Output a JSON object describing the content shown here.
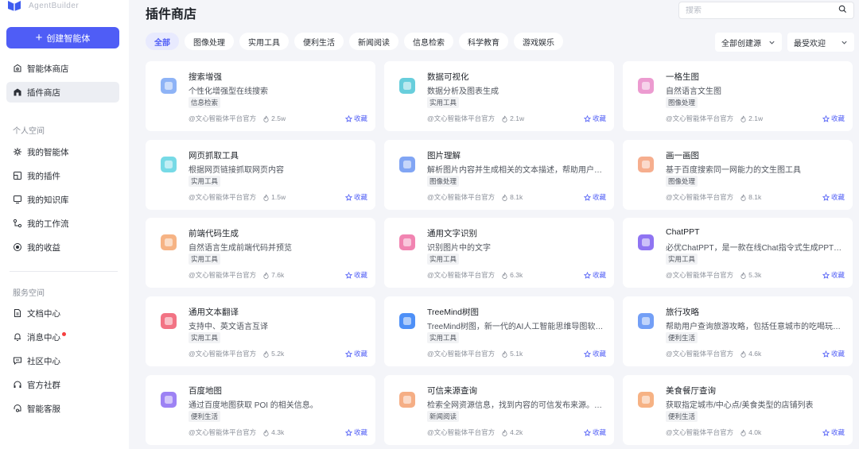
{
  "brand": {
    "name": "AgentBuilder",
    "color": "#3f5cf0"
  },
  "sidebar": {
    "create_label": "创建智能体",
    "top_items": [
      {
        "label": "智能体商店",
        "icon": "store-icon"
      },
      {
        "label": "插件商店",
        "icon": "plugin-store-icon",
        "active": true
      }
    ],
    "personal_title": "个人空间",
    "personal_items": [
      {
        "label": "我的智能体",
        "icon": "agent-icon"
      },
      {
        "label": "我的插件",
        "icon": "plugin-icon"
      },
      {
        "label": "我的知识库",
        "icon": "knowledge-icon"
      },
      {
        "label": "我的工作流",
        "icon": "workflow-icon"
      },
      {
        "label": "我的收益",
        "icon": "income-icon"
      }
    ],
    "service_title": "服务空间",
    "service_items": [
      {
        "label": "文档中心",
        "icon": "document-icon"
      },
      {
        "label": "消息中心",
        "icon": "bell-icon",
        "badge": true
      },
      {
        "label": "社区中心",
        "icon": "community-icon"
      },
      {
        "label": "官方社群",
        "icon": "headset-icon"
      },
      {
        "label": "智能客服",
        "icon": "support-icon"
      }
    ]
  },
  "header": {
    "title": "插件商店",
    "search_placeholder": "搜索"
  },
  "tabs": [
    "全部",
    "图像处理",
    "实用工具",
    "便利生活",
    "新闻阅读",
    "信息检索",
    "科学教育",
    "游戏娱乐"
  ],
  "active_tab": 0,
  "filters": {
    "source": "全部创建源",
    "sort": "最受欢迎"
  },
  "accent_color": "#4f5df6",
  "cards": [
    {
      "name": "搜索增强",
      "desc": "个性化增强型在线搜索",
      "tag": "信息检索",
      "author": "@文心智能体平台官方",
      "heat": "2.5w",
      "fav": "收藏",
      "icon": "search-enhance-icon",
      "color": "#7aa6f5"
    },
    {
      "name": "数据可视化",
      "desc": "数据分析及图表生成",
      "tag": "实用工具",
      "author": "@文心智能体平台官方",
      "heat": "2.1w",
      "fav": "收藏",
      "icon": "data-viz-icon",
      "color": "#4ec6d6"
    },
    {
      "name": "一格生图",
      "desc": "自然语言文生图",
      "tag": "图像处理",
      "author": "@文心智能体平台官方",
      "heat": "2.1w",
      "fav": "收藏",
      "icon": "image-gen-icon",
      "color": "#e98ac8"
    },
    {
      "name": "网页抓取工具",
      "desc": "根据网页链接抓取网页内容",
      "tag": "实用工具",
      "author": "@文心智能体平台官方",
      "heat": "1.5w",
      "fav": "收藏",
      "icon": "web-scrape-icon",
      "color": "#5fd4e2"
    },
    {
      "name": "图片理解",
      "desc": "解析图片内容并生成相关的文本描述，帮助用户理...",
      "tag": "图像处理",
      "author": "@文心智能体平台官方",
      "heat": "8.1k",
      "fav": "收藏",
      "icon": "image-understand-icon",
      "color": "#6b95f2"
    },
    {
      "name": "画一画图",
      "desc": "基于百度搜索同一网能力的文生图工具",
      "tag": "图像处理",
      "author": "@文心智能体平台官方",
      "heat": "8.1k",
      "fav": "收藏",
      "icon": "draw-icon",
      "color": "#f4a07a"
    },
    {
      "name": "前端代码生成",
      "desc": "自然语言生成前端代码并预览",
      "tag": "实用工具",
      "author": "@文心智能体平台官方",
      "heat": "7.6k",
      "fav": "收藏",
      "icon": "code-gen-icon",
      "color": "#f5a66e"
    },
    {
      "name": "通用文字识别",
      "desc": "识别图片中的文字",
      "tag": "实用工具",
      "author": "@文心智能体平台官方",
      "heat": "6.3k",
      "fav": "收藏",
      "icon": "ocr-icon",
      "color": "#ef6ea3"
    },
    {
      "name": "ChatPPT",
      "desc": "必优ChatPPT，是一款在线Chat指令式生成PPT产品...",
      "tag": "实用工具",
      "author": "@文心智能体平台官方",
      "heat": "5.3k",
      "fav": "收藏",
      "icon": "chatppt-icon",
      "color": "#7b5cf0"
    },
    {
      "name": "通用文本翻译",
      "desc": "支持中、英文语言互译",
      "tag": "实用工具",
      "author": "@文心智能体平台官方",
      "heat": "5.2k",
      "fav": "收藏",
      "icon": "translate-icon",
      "color": "#f05a6e"
    },
    {
      "name": "TreeMind树图",
      "desc": "TreeMind树图，新一代的AI人工智能思维导图软件...",
      "tag": "实用工具",
      "author": "@文心智能体平台官方",
      "heat": "5.1k",
      "fav": "收藏",
      "icon": "treemind-icon",
      "color": "#2f7df6"
    },
    {
      "name": "旅行攻略",
      "desc": "帮助用户查询旅游攻略，包括任意城市的吃喝玩乐...",
      "tag": "便利生活",
      "author": "@文心智能体平台官方",
      "heat": "4.6k",
      "fav": "收藏",
      "icon": "travel-icon",
      "color": "#5b8ef5"
    },
    {
      "name": "百度地图",
      "desc": "通过百度地图获取 POI 的相关信息。",
      "tag": "便利生活",
      "author": "@文心智能体平台官方",
      "heat": "4.3k",
      "fav": "收藏",
      "icon": "map-icon",
      "color": "#8c6cf2"
    },
    {
      "name": "可信来源查询",
      "desc": "检索全网资源信息，找到内容的可信发布来源。适...",
      "tag": "新闻阅读",
      "author": "@文心智能体平台官方",
      "heat": "4.2k",
      "fav": "收藏",
      "icon": "source-check-icon",
      "color": "#f3a070"
    },
    {
      "name": "美食餐厅查询",
      "desc": "获取指定城市/中心点/美食类型的店铺列表",
      "tag": "便利生活",
      "author": "@文心智能体平台官方",
      "heat": "4.0k",
      "fav": "收藏",
      "icon": "restaurant-icon",
      "color": "#f5a56f"
    }
  ]
}
